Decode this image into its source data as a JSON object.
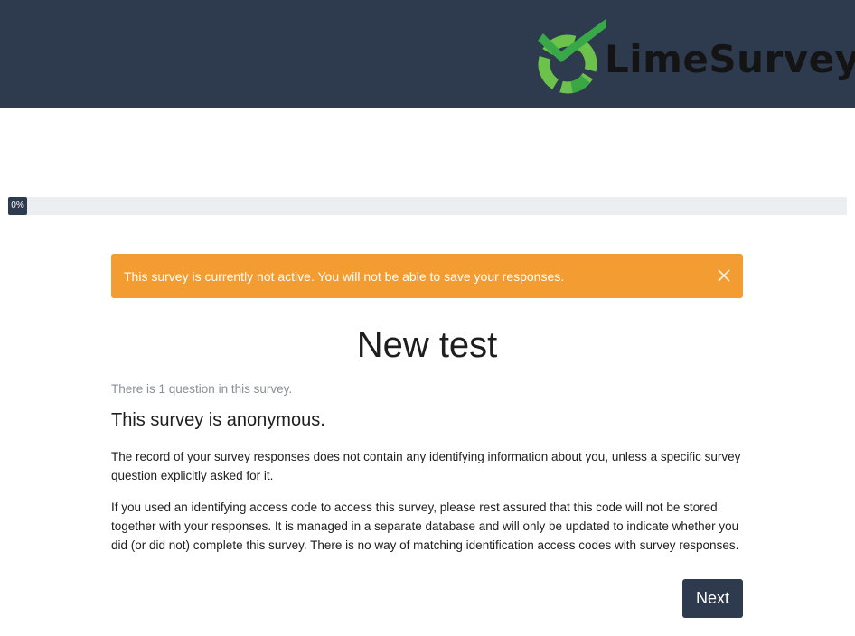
{
  "header": {
    "logo_text": "LimeSurvey",
    "logo_icon": "limesurvey-logo-icon",
    "background_color": "#2e3a4e"
  },
  "progress": {
    "percent": 0,
    "label": "0%"
  },
  "alert": {
    "message": "This survey is currently not active. You will not be able to save your responses.",
    "close_icon": "close-icon",
    "color": "#f39c32"
  },
  "survey": {
    "title": "New test",
    "question_count_text": "There is 1 question in this survey.",
    "anonymous_heading": "This survey is anonymous.",
    "paragraph_1": "The record of your survey responses does not contain any identifying information about you, unless a specific survey question explicitly asked for it.",
    "paragraph_2": "If you used an identifying access code to access this survey, please rest assured that this code will not be stored together with your responses. It is managed in a separate database and will only be updated to indicate whether you did (or did not) complete this survey. There is no way of matching identification access codes with survey responses."
  },
  "navigation": {
    "next_label": "Next"
  }
}
